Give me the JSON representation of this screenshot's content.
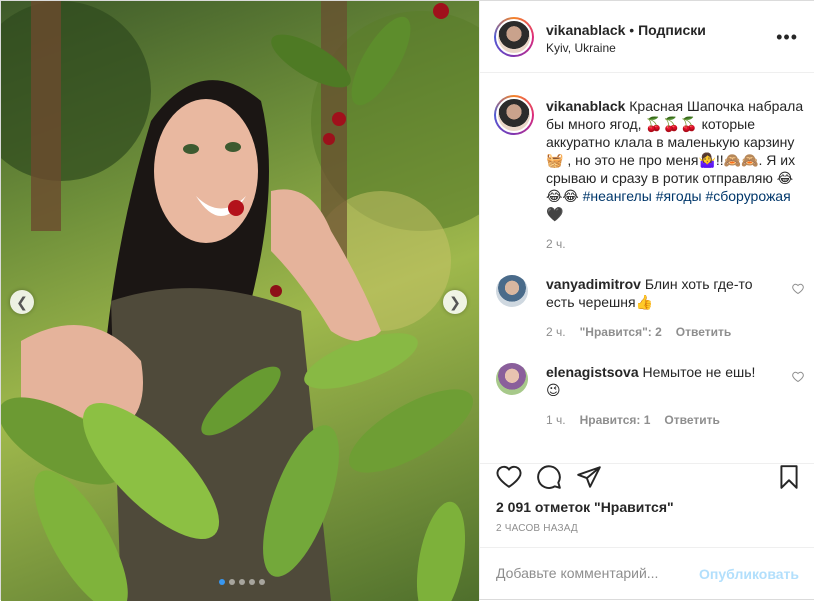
{
  "header": {
    "username": "vikanablack",
    "separator": "•",
    "follow_label": "Подписки",
    "location": "Kyiv, Ukraine",
    "more_icon": "•••"
  },
  "caption": {
    "username": "vikanablack",
    "text_before": "Красная Шапочка набрала бы много ягод, 🍒🍒🍒 которые аккуратно клала в маленькую карзину🧺 , но это не про меня🤷‍♀️!!🙈🙈. Я их срываю и сразу в ротик отправляю 😂😂😂 ",
    "tag1": "#неангелы",
    "tag2": "#ягоды",
    "tag3": "#сборурожая",
    "text_after": " 🖤",
    "time": "2 ч."
  },
  "comments": [
    {
      "username": "vanyadimitrov",
      "text": "Блин хоть где-то есть черешня👍",
      "time": "2 ч.",
      "likes": "\"Нравится\": 2",
      "reply": "Ответить"
    },
    {
      "username": "elenagistsova",
      "text": "Немытое не ешь! 😉",
      "time": "1 ч.",
      "likes": "Нравится: 1",
      "reply": "Ответить"
    }
  ],
  "likes_text": "2 091 отметок \"Нравится\"",
  "time_ago": "2 ЧАСОВ НАЗАД",
  "add_comment": {
    "placeholder": "Добавьте комментарий...",
    "publish_label": "Опубликовать"
  },
  "icons": {
    "like": "heart-icon",
    "comment": "comment-icon",
    "share": "share-icon",
    "save": "bookmark-icon",
    "prev": "chevron-left-icon",
    "next": "chevron-right-icon"
  },
  "colors": {
    "accent": "#3897f0",
    "hashtag": "#00376b",
    "muted": "#8e8e8e",
    "publish_disabled": "#b2dffc"
  },
  "carousel": {
    "slides": 5,
    "current": 1
  }
}
